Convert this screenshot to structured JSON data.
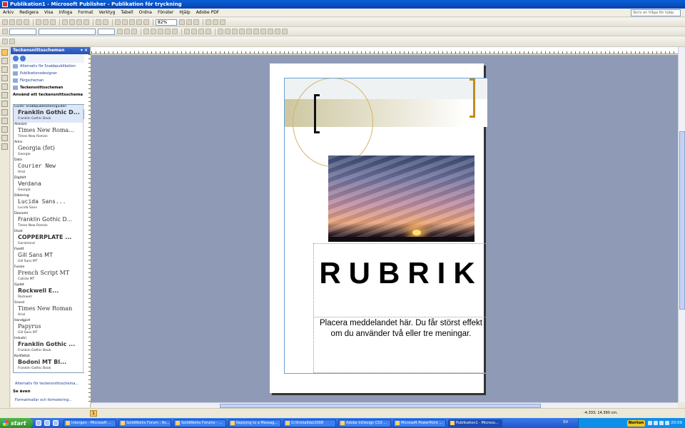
{
  "window": {
    "title": "Publikation1 - Microsoft Publisher - Publikation för tryckning"
  },
  "menu": {
    "items": [
      "Arkiv",
      "Redigera",
      "Visa",
      "Infoga",
      "Format",
      "Verktyg",
      "Tabell",
      "Ordna",
      "Fönster",
      "Hjälp",
      "Adobe PDF"
    ],
    "help_placeholder": "Skriv en fråga för hjälp"
  },
  "toolbar": {
    "zoom": "82%"
  },
  "taskpane": {
    "title": "Teckensnittsscheman",
    "links": [
      "Alternativ för Snabbpublikation",
      "Publikationsdesigner",
      "Färgscheman",
      "Teckensnittsscheman"
    ],
    "subtitle": "Använd ett teckensnittsschema",
    "schemes": [
      {
        "name": "Guide: Snabbpublikationsguiden",
        "major": "Franklin Gothic D...",
        "minor": "Franklin Gothic Book",
        "style": "b"
      },
      {
        "name": "Allmänt",
        "major": "Times New Roma...",
        "minor": "Times New Roman",
        "style": "serif"
      },
      {
        "name": "Arkiv",
        "major": "Georgia (fet)",
        "minor": "Georgia",
        "style": "serif"
      },
      {
        "name": "Data",
        "major": "Courier New",
        "minor": "Arial",
        "style": "mono"
      },
      {
        "name": "Digitalt",
        "major": "Verdana",
        "minor": "Georgia",
        "style": ""
      },
      {
        "name": "Diktering",
        "major": "Lucida Sans...",
        "minor": "Lucida Sans",
        "style": "mono"
      },
      {
        "name": "Ekonomi",
        "major": "Franklin Gothic D...",
        "minor": "Times New Roman",
        "style": ""
      },
      {
        "name": "Etsat",
        "major": "COPPERPLATE ...",
        "minor": "Garamond",
        "style": "b"
      },
      {
        "name": "Fasett",
        "major": "Gill Sans MT",
        "minor": "Gill Sans MT",
        "style": ""
      },
      {
        "name": "Fusion",
        "major": "French Script MT",
        "minor": "Calisto MT",
        "style": "serif"
      },
      {
        "name": "Gjutet",
        "major": "Rockwell E...",
        "minor": "Rockwell",
        "style": "b"
      },
      {
        "name": "Grund",
        "major": "Times New Roman",
        "minor": "Arial",
        "style": "serif"
      },
      {
        "name": "Handgjort",
        "major": "Papyrus",
        "minor": "Gill Sans MT",
        "style": "serif"
      },
      {
        "name": "Industri",
        "major": "Franklin Gothic ...",
        "minor": "Franklin Gothic Book",
        "style": "b"
      },
      {
        "name": "Kortfattat",
        "major": "Bodoni MT Bl...",
        "minor": "Franklin Gothic Book",
        "style": "b"
      }
    ],
    "footer_link1": "Alternativ för teckensnittsschema...",
    "see_also": "Se även",
    "footer_link2": "Formatmallar och formatering..."
  },
  "page": {
    "headline": "RUBRIK",
    "message": "Placera meddelandet här. Du får störst effekt om du använder två eller tre meningar."
  },
  "status": {
    "page_number": "1",
    "coords": "-4,333; 14,390 cm."
  },
  "taskbar": {
    "start": "start",
    "tasks": [
      "Inkorgen - Microsoft ...",
      "SolidWorks Forum : As...",
      "SolidWorks Forums - ...",
      "Replying to a Messag...",
      "G:\\Kristallda\\2008",
      "Adobe InDesign CS3 ...",
      "Microsoft PowerPoint ...",
      "Publikation1 - Microso..."
    ],
    "lang": "SV",
    "norton": "Norton",
    "clock": "20:59"
  },
  "colors": {
    "accent_gold": "#c08b1e",
    "canvas": "#8f9bb6",
    "title_blue": "#0842b0"
  }
}
